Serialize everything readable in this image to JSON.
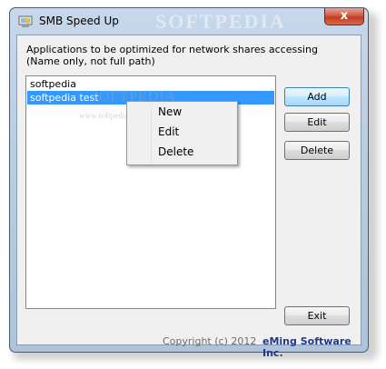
{
  "window": {
    "title": "SMB Speed Up",
    "close_glyph": "x",
    "watermark": "SOFTPEDIA"
  },
  "main": {
    "description_line1": "Applications to be optimized for network shares accessing",
    "description_line2": "(Name only, not full path)",
    "list_items": [
      {
        "label": "softpedia",
        "selected": false
      },
      {
        "label": "softpedia test",
        "selected": true
      }
    ],
    "list_watermark": "SOFTPEDIA",
    "list_watermark_url": "www.softpedia.com"
  },
  "buttons": {
    "add": "Add",
    "edit": "Edit",
    "delete": "Delete",
    "exit": "Exit"
  },
  "context_menu": {
    "items": [
      "New",
      "Edit",
      "Delete"
    ]
  },
  "footer": {
    "copyright": "Copyright (c) 2012",
    "company": "eMing Software Inc."
  },
  "icons": {
    "app_icon": "app-icon",
    "close": "close-icon"
  },
  "colors": {
    "selection": "#3399ff",
    "company_text": "#1f3a8a",
    "close_button": "#c23b22"
  }
}
